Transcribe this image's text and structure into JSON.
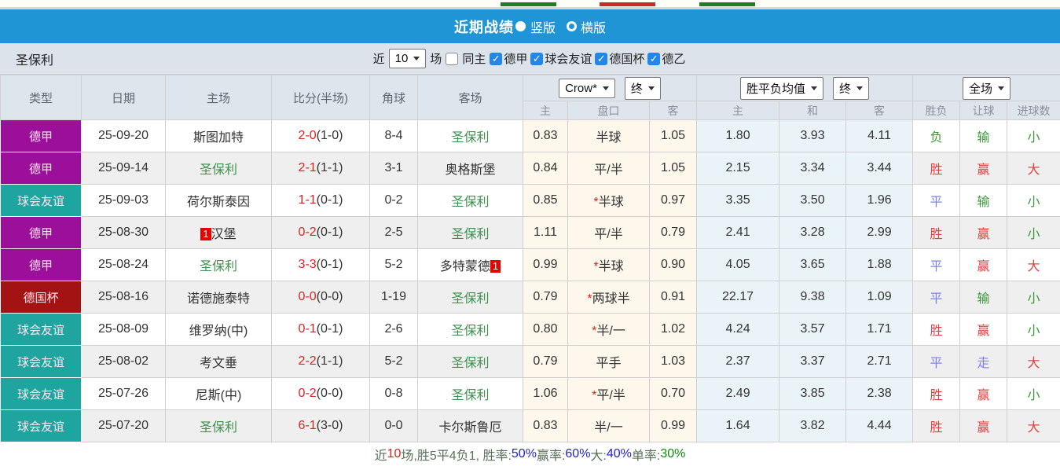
{
  "colors": {
    "accent_blue": "#2095d5",
    "type": {
      "德甲": "#9b0f9b",
      "球会友谊": "#1fa5a0",
      "德国杯": "#a31313"
    },
    "result": {
      "red": "#e04040",
      "green": "#3a9a3a",
      "blue": "#8080ee"
    },
    "target_team_green": "#3f9150",
    "score_red": "#e02020"
  },
  "title_bar": {
    "title": "近期战绩",
    "radio_vertical_label": "竖版",
    "radio_horizontal_label": "横版"
  },
  "filter": {
    "team": "圣保利",
    "near_label": "近",
    "matches_value": "10",
    "matches_label": "场",
    "same_home_label": "同主",
    "leagues": [
      {
        "label": "德甲",
        "checked": true
      },
      {
        "label": "球会友谊",
        "checked": true
      },
      {
        "label": "德国杯",
        "checked": true
      },
      {
        "label": "德乙",
        "checked": true
      }
    ]
  },
  "table": {
    "headers": [
      "类型",
      "日期",
      "主场",
      "比分(半场)",
      "角球",
      "客场"
    ],
    "dropdowns": {
      "company": "Crow*",
      "time1": "终",
      "avg": "胜平负均值",
      "time2": "终",
      "scope": "全场"
    },
    "subheaders": [
      "主",
      "盘口",
      "客",
      "主",
      "和",
      "客",
      "胜负",
      "让球",
      "进球数"
    ],
    "rows": [
      {
        "type": "德甲",
        "date": "25-09-20",
        "home": "斯图加特",
        "homeTarget": false,
        "homeBadge": "",
        "homeBadgeSide": "",
        "score": "2-0",
        "half": "(1-0)",
        "corner": "8-4",
        "away": "圣保利",
        "awayTarget": true,
        "awayBadge": "",
        "awayBadgeSide": "",
        "oddsHome": "0.83",
        "handicap": "半球",
        "star": false,
        "oddsAway": "1.05",
        "avgWin": "1.80",
        "avgDraw": "3.93",
        "avgLose": "4.11",
        "res": [
          [
            "负",
            "green"
          ],
          [
            "输",
            "green"
          ],
          [
            "小",
            "green"
          ]
        ]
      },
      {
        "type": "德甲",
        "date": "25-09-14",
        "home": "圣保利",
        "homeTarget": true,
        "homeBadge": "",
        "homeBadgeSide": "",
        "score": "2-1",
        "half": "(1-1)",
        "corner": "3-1",
        "away": "奥格斯堡",
        "awayTarget": false,
        "awayBadge": "",
        "awayBadgeSide": "",
        "oddsHome": "0.84",
        "handicap": "平/半",
        "star": false,
        "oddsAway": "1.05",
        "avgWin": "2.15",
        "avgDraw": "3.34",
        "avgLose": "3.44",
        "res": [
          [
            "胜",
            "red"
          ],
          [
            "赢",
            "red"
          ],
          [
            "大",
            "red"
          ]
        ]
      },
      {
        "type": "球会友谊",
        "date": "25-09-03",
        "home": "荷尔斯泰因",
        "homeTarget": false,
        "homeBadge": "",
        "homeBadgeSide": "",
        "score": "1-1",
        "half": "(0-1)",
        "corner": "0-2",
        "away": "圣保利",
        "awayTarget": true,
        "awayBadge": "",
        "awayBadgeSide": "",
        "oddsHome": "0.85",
        "handicap": "半球",
        "star": true,
        "oddsAway": "0.97",
        "avgWin": "3.35",
        "avgDraw": "3.50",
        "avgLose": "1.96",
        "res": [
          [
            "平",
            "blue"
          ],
          [
            "输",
            "green"
          ],
          [
            "小",
            "green"
          ]
        ]
      },
      {
        "type": "德甲",
        "date": "25-08-30",
        "home": "汉堡",
        "homeTarget": false,
        "homeBadge": "1",
        "homeBadgeSide": "left",
        "score": "0-2",
        "half": "(0-1)",
        "corner": "2-5",
        "away": "圣保利",
        "awayTarget": true,
        "awayBadge": "",
        "awayBadgeSide": "",
        "oddsHome": "1.11",
        "handicap": "平/半",
        "star": false,
        "oddsAway": "0.79",
        "avgWin": "2.41",
        "avgDraw": "3.28",
        "avgLose": "2.99",
        "res": [
          [
            "胜",
            "red"
          ],
          [
            "赢",
            "red"
          ],
          [
            "小",
            "green"
          ]
        ]
      },
      {
        "type": "德甲",
        "date": "25-08-24",
        "home": "圣保利",
        "homeTarget": true,
        "homeBadge": "",
        "homeBadgeSide": "",
        "score": "3-3",
        "half": "(0-1)",
        "corner": "5-2",
        "away": "多特蒙德",
        "awayTarget": false,
        "awayBadge": "1",
        "awayBadgeSide": "right",
        "oddsHome": "0.99",
        "handicap": "半球",
        "star": true,
        "oddsAway": "0.90",
        "avgWin": "4.05",
        "avgDraw": "3.65",
        "avgLose": "1.88",
        "res": [
          [
            "平",
            "blue"
          ],
          [
            "赢",
            "red"
          ],
          [
            "大",
            "red"
          ]
        ]
      },
      {
        "type": "德国杯",
        "date": "25-08-16",
        "home": "诺德施泰特",
        "homeTarget": false,
        "homeBadge": "",
        "homeBadgeSide": "",
        "score": "0-0",
        "half": "(0-0)",
        "corner": "1-19",
        "away": "圣保利",
        "awayTarget": true,
        "awayBadge": "",
        "awayBadgeSide": "",
        "oddsHome": "0.79",
        "handicap": "两球半",
        "star": true,
        "oddsAway": "0.91",
        "avgWin": "22.17",
        "avgDraw": "9.38",
        "avgLose": "1.09",
        "res": [
          [
            "平",
            "blue"
          ],
          [
            "输",
            "green"
          ],
          [
            "小",
            "green"
          ]
        ]
      },
      {
        "type": "球会友谊",
        "date": "25-08-09",
        "home": "维罗纳(中)",
        "homeTarget": false,
        "homeBadge": "",
        "homeBadgeSide": "",
        "score": "0-1",
        "half": "(0-1)",
        "corner": "2-6",
        "away": "圣保利",
        "awayTarget": true,
        "awayBadge": "",
        "awayBadgeSide": "",
        "oddsHome": "0.80",
        "handicap": "半/一",
        "star": true,
        "oddsAway": "1.02",
        "avgWin": "4.24",
        "avgDraw": "3.57",
        "avgLose": "1.71",
        "res": [
          [
            "胜",
            "red"
          ],
          [
            "赢",
            "red"
          ],
          [
            "小",
            "green"
          ]
        ]
      },
      {
        "type": "球会友谊",
        "date": "25-08-02",
        "home": "考文垂",
        "homeTarget": false,
        "homeBadge": "",
        "homeBadgeSide": "",
        "score": "2-2",
        "half": "(1-1)",
        "corner": "5-2",
        "away": "圣保利",
        "awayTarget": true,
        "awayBadge": "",
        "awayBadgeSide": "",
        "oddsHome": "0.79",
        "handicap": "平手",
        "star": false,
        "oddsAway": "1.03",
        "avgWin": "2.37",
        "avgDraw": "3.37",
        "avgLose": "2.71",
        "res": [
          [
            "平",
            "blue"
          ],
          [
            "走",
            "blue"
          ],
          [
            "大",
            "red"
          ]
        ]
      },
      {
        "type": "球会友谊",
        "date": "25-07-26",
        "home": "尼斯(中)",
        "homeTarget": false,
        "homeBadge": "",
        "homeBadgeSide": "",
        "score": "0-2",
        "half": "(0-0)",
        "corner": "0-8",
        "away": "圣保利",
        "awayTarget": true,
        "awayBadge": "",
        "awayBadgeSide": "",
        "oddsHome": "1.06",
        "handicap": "平/半",
        "star": true,
        "oddsAway": "0.70",
        "avgWin": "2.49",
        "avgDraw": "3.85",
        "avgLose": "2.38",
        "res": [
          [
            "胜",
            "red"
          ],
          [
            "赢",
            "red"
          ],
          [
            "小",
            "green"
          ]
        ]
      },
      {
        "type": "球会友谊",
        "date": "25-07-20",
        "home": "圣保利",
        "homeTarget": true,
        "homeBadge": "",
        "homeBadgeSide": "",
        "score": "6-1",
        "half": "(3-0)",
        "corner": "0-0",
        "away": "卡尔斯鲁厄",
        "awayTarget": false,
        "awayBadge": "",
        "awayBadgeSide": "",
        "oddsHome": "0.83",
        "handicap": "半/一",
        "star": false,
        "oddsAway": "0.99",
        "avgWin": "1.64",
        "avgDraw": "3.82",
        "avgLose": "4.44",
        "res": [
          [
            "胜",
            "red"
          ],
          [
            "赢",
            "red"
          ],
          [
            "大",
            "red"
          ]
        ]
      }
    ]
  },
  "summary": {
    "parts": [
      {
        "text": "近",
        "c": "label"
      },
      {
        "text": "10",
        "c": "red"
      },
      {
        "text": "场,胜5平4负1, 胜率:",
        "c": "label"
      },
      {
        "text": "50%",
        "c": "blue"
      },
      {
        "text": " 赢率:",
        "c": "label"
      },
      {
        "text": "60%",
        "c": "blue"
      },
      {
        "text": " 大:",
        "c": "label"
      },
      {
        "text": "40%",
        "c": "blue"
      },
      {
        "text": " 单率:",
        "c": "label"
      },
      {
        "text": "30%",
        "c": "green"
      }
    ]
  }
}
